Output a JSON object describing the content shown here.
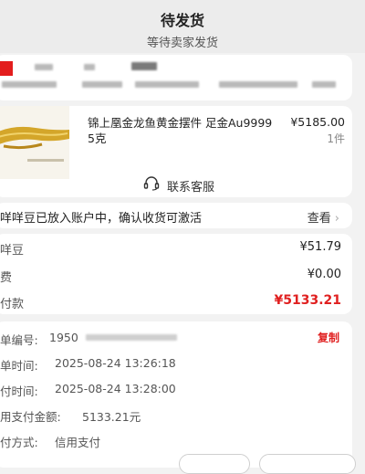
{
  "header": {
    "title": "待发货",
    "subtitle": "等待卖家发货"
  },
  "product": {
    "name": "锦上凰金龙鱼黄金摆件 足金Au9999 5克",
    "price": "¥5185.00",
    "quantity": "1件",
    "customer_service_label": "联系客服"
  },
  "notice": {
    "text": "咩咩豆已放入账户中，确认收货可激活",
    "link_label": "查看"
  },
  "price_rows": [
    {
      "label": "咩豆",
      "value": "¥51.79"
    },
    {
      "label": "费",
      "value": "¥0.00"
    },
    {
      "label": "付款",
      "value": "¥5133.21"
    }
  ],
  "details": {
    "copy_label": "复制",
    "rows": [
      {
        "label": "单编号:",
        "value": "1950"
      },
      {
        "label": "单时间:",
        "value": "2025-08-24 13:26:18"
      },
      {
        "label": "付时间:",
        "value": "2025-08-24 13:28:00"
      },
      {
        "label": "用支付金额:",
        "value": "5133.21元"
      },
      {
        "label": "付方式:",
        "value": "信用支付"
      }
    ]
  },
  "colors": {
    "accent_red": "#e02020",
    "background": "#f2f2f2"
  }
}
